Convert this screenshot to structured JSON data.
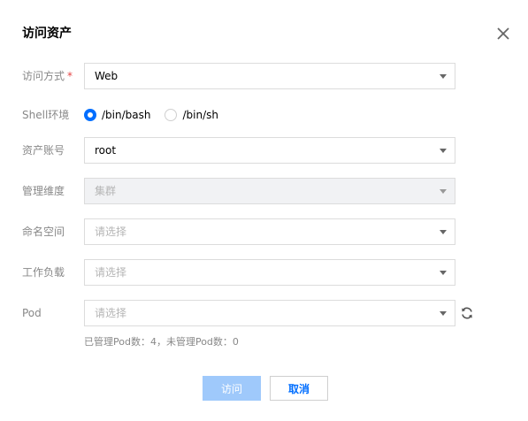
{
  "dialog": {
    "title": "访问资产",
    "close_icon": "close-icon"
  },
  "form": {
    "access_method": {
      "label": "访问方式",
      "required_mark": "*",
      "value": "Web"
    },
    "shell_env": {
      "label": "Shell环境",
      "options": [
        {
          "label": "/bin/bash",
          "selected": true
        },
        {
          "label": "/bin/sh",
          "selected": false
        }
      ]
    },
    "account": {
      "label": "资产账号",
      "value": "root"
    },
    "management_dimension": {
      "label": "管理维度",
      "value": "集群",
      "disabled": true
    },
    "namespace": {
      "label": "命名空间",
      "placeholder": "请选择"
    },
    "workload": {
      "label": "工作负载",
      "placeholder": "请选择"
    },
    "pod": {
      "label": "Pod",
      "placeholder": "请选择",
      "refresh_icon": "refresh-icon"
    },
    "pod_hint": "已管理Pod数：4，未管理Pod数：0"
  },
  "buttons": {
    "submit_label": "访问",
    "cancel_label": "取消"
  },
  "colors": {
    "primary": "#006eff",
    "primary_disabled": "#9fc9fb",
    "required": "#e54545"
  }
}
